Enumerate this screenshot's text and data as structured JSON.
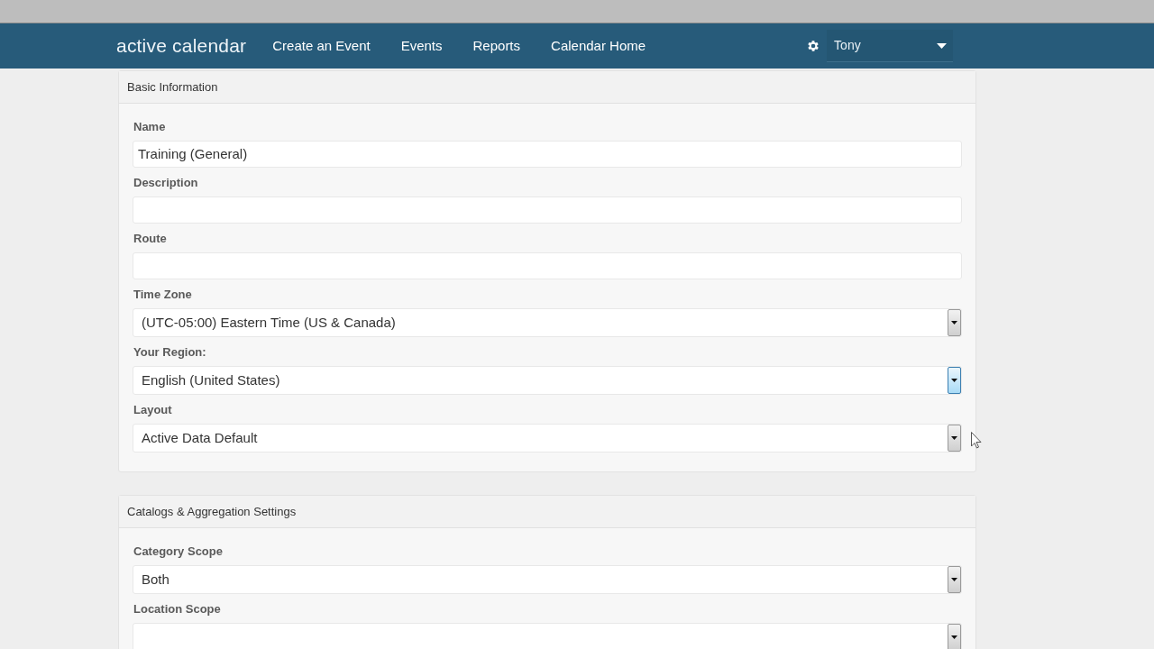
{
  "top_bar": {
    "logo": "active calendar",
    "nav": [
      {
        "label": "Create an Event"
      },
      {
        "label": "Events"
      },
      {
        "label": "Reports"
      },
      {
        "label": "Calendar Home"
      }
    ],
    "user": {
      "name": "Tony"
    }
  },
  "sections": [
    {
      "title": "Basic Information",
      "fields": [
        {
          "kind": "text",
          "label": "Name",
          "value": "Training (General)"
        },
        {
          "kind": "text",
          "label": "Description"
        },
        {
          "kind": "text",
          "label": "Route"
        },
        {
          "kind": "select",
          "label": "Time Zone",
          "value": "(UTC-05:00) Eastern Time (US & Canada)",
          "focused": false
        },
        {
          "kind": "select",
          "label": "Your Region:",
          "value": "English (United States)",
          "focused": true
        },
        {
          "kind": "select",
          "label": "Layout",
          "value": "Active Data Default",
          "focused": false
        }
      ]
    },
    {
      "title": "Catalogs & Aggregation Settings",
      "fields": [
        {
          "kind": "select",
          "label": "Category Scope",
          "value": "Both",
          "focused": false
        },
        {
          "kind": "select",
          "label": "Location Scope",
          "focused": false
        }
      ]
    }
  ]
}
